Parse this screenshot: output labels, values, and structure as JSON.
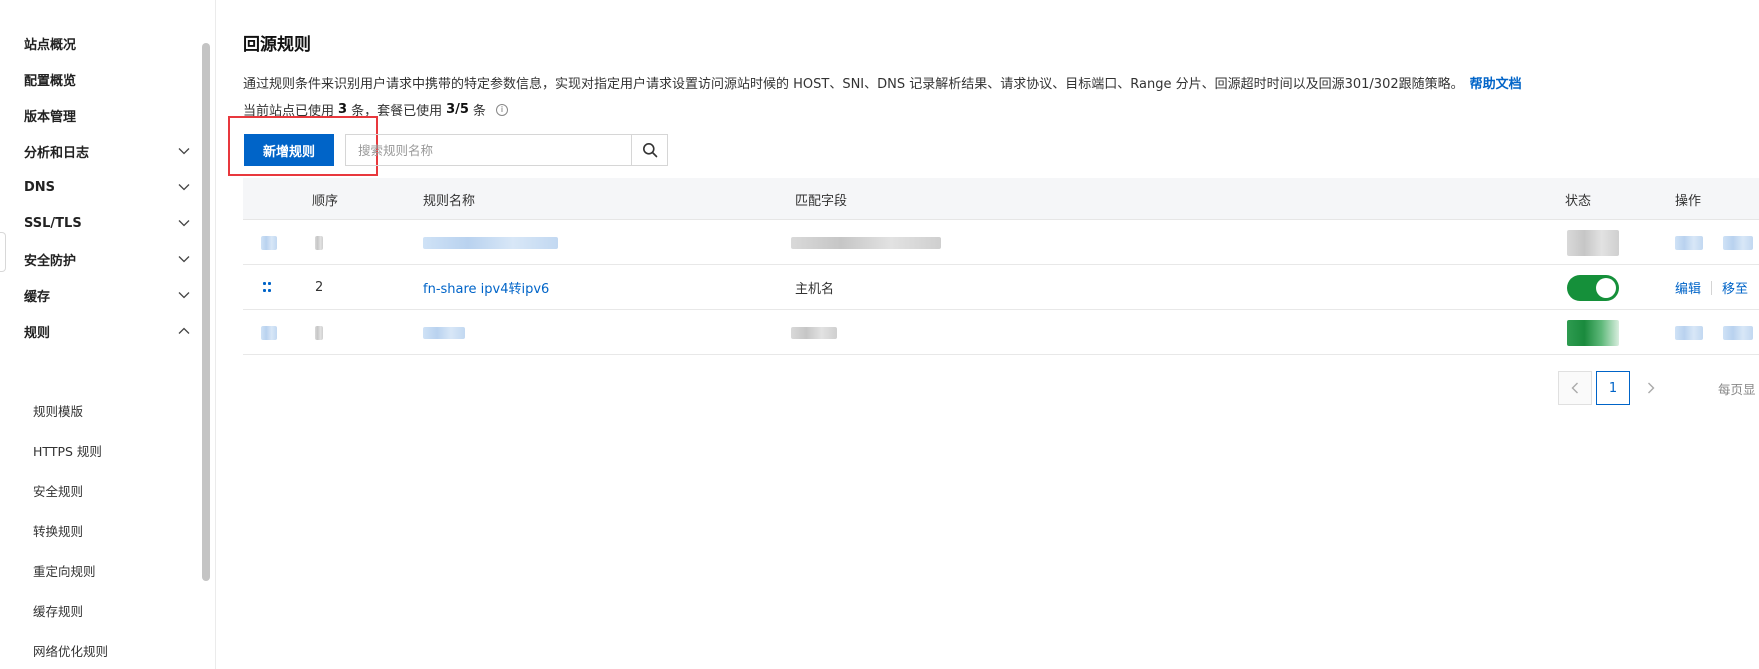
{
  "sidebar": {
    "items": [
      {
        "label": "站点概况",
        "expandable": false
      },
      {
        "label": "配置概览",
        "expandable": false
      },
      {
        "label": "版本管理",
        "expandable": false
      },
      {
        "label": "分析和日志",
        "expandable": true,
        "expanded": false
      },
      {
        "label": "DNS",
        "expandable": true,
        "expanded": false
      },
      {
        "label": "SSL/TLS",
        "expandable": true,
        "expanded": false
      },
      {
        "label": "安全防护",
        "expandable": true,
        "expanded": false
      },
      {
        "label": "缓存",
        "expandable": true,
        "expanded": false
      },
      {
        "label": "规则",
        "expandable": true,
        "expanded": true
      }
    ],
    "sub_items": [
      "规则模版",
      "HTTPS 规则",
      "安全规则",
      "转换规则",
      "重定向规则",
      "缓存规则",
      "网络优化规则"
    ]
  },
  "main": {
    "title": "回源规则",
    "description": "通过规则条件来识别用户请求中携带的特定参数信息，实现对指定用户请求设置访问源站时候的 HOST、SNI、DNS 记录解析结果、请求协议、目标端口、Range 分片、回源超时时间以及回源301/302跟随策略。",
    "help_link": "帮助文档",
    "usage": {
      "prefix": "当前站点已使用",
      "site_count": "3",
      "mid": "条，套餐已使用",
      "plan_usage": "3/5",
      "suffix": "条"
    },
    "add_button": "新增规则",
    "search_placeholder": "搜索规则名称"
  },
  "table": {
    "headers": {
      "order": "顺序",
      "name": "规则名称",
      "match": "匹配字段",
      "status": "状态",
      "actions": "操作"
    },
    "rows": [
      {
        "blurred": true
      },
      {
        "blurred": false,
        "order": "2",
        "name": "fn-share ipv4转ipv6",
        "match": "主机名",
        "enabled": true,
        "edit": "编辑",
        "move": "移至"
      },
      {
        "blurred": true
      }
    ]
  },
  "pagination": {
    "current_page": "1",
    "page_size_label": "每页显"
  },
  "colors": {
    "primary": "#0064c8",
    "toggle_on": "#15903a",
    "highlight": "#e8383d"
  }
}
